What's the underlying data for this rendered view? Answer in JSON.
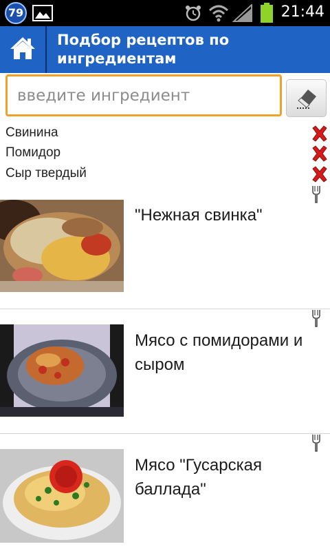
{
  "status_bar": {
    "notification_count": "79",
    "time": "21:44"
  },
  "header": {
    "title": "Подбор рецептов по ингредиентам"
  },
  "search": {
    "placeholder": "введите ингредиент"
  },
  "ingredients": [
    {
      "label": "Свинина"
    },
    {
      "label": "Помидор"
    },
    {
      "label": "Сыр твердый"
    }
  ],
  "recipes": [
    {
      "title": "\"Нежная свинка\""
    },
    {
      "title": "Мясо с помидорами и сыром"
    },
    {
      "title": "Мясо \"Гусарская баллада\""
    }
  ],
  "colors": {
    "header_bg": "#1f63c4",
    "search_border": "#f0a12a",
    "remove_red": "#d41a1a"
  }
}
